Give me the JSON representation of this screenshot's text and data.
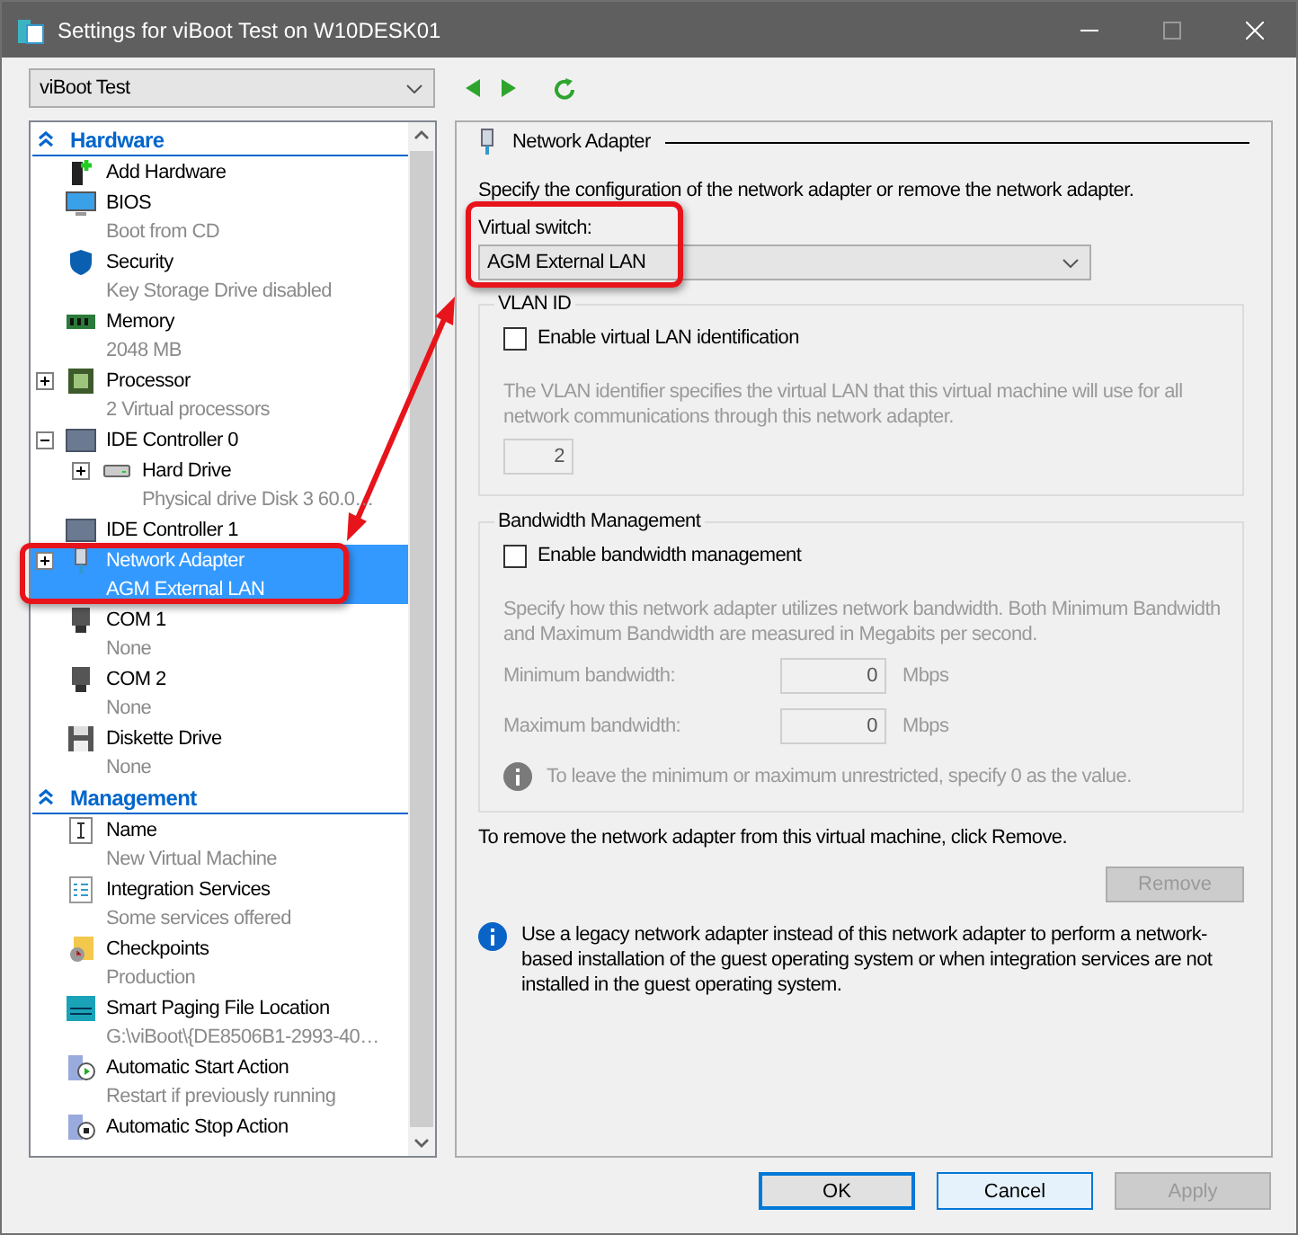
{
  "window": {
    "title": "Settings for viBoot Test on W10DESK01"
  },
  "vm_selector": {
    "value": "viBoot Test"
  },
  "sidebar": {
    "sections": [
      {
        "title": "Hardware",
        "expanded": true,
        "items": [
          {
            "kind": "add-hardware",
            "label": "Add Hardware",
            "selected": false
          },
          {
            "kind": "bios",
            "label": "BIOS",
            "detail": "Boot from CD",
            "selected": false
          },
          {
            "kind": "security",
            "label": "Security",
            "detail": "Key Storage Drive disabled",
            "selected": false
          },
          {
            "kind": "memory",
            "label": "Memory",
            "detail": "2048 MB",
            "selected": false
          },
          {
            "kind": "processor",
            "label": "Processor",
            "detail": "2 Virtual processors",
            "selected": false,
            "expanded": false
          },
          {
            "kind": "controller",
            "label": "IDE Controller 0",
            "selected": false,
            "expanded": true,
            "children": [
              {
                "kind": "hard-drive",
                "label": "Hard Drive",
                "detail": "Physical drive Disk 3 60.0…",
                "selected": false,
                "expanded": false
              }
            ]
          },
          {
            "kind": "controller",
            "label": "IDE Controller 1",
            "selected": false
          },
          {
            "kind": "network",
            "label": "Network Adapter",
            "detail": "AGM External LAN",
            "selected": true,
            "expanded": false
          },
          {
            "kind": "port",
            "label": "COM 1",
            "detail": "None",
            "selected": false
          },
          {
            "kind": "port",
            "label": "COM 2",
            "detail": "None",
            "selected": false
          },
          {
            "kind": "diskette",
            "label": "Diskette Drive",
            "detail": "None",
            "selected": false
          }
        ]
      },
      {
        "title": "Management",
        "expanded": true,
        "items": [
          {
            "kind": "name",
            "label": "Name",
            "detail": "New Virtual Machine",
            "selected": false
          },
          {
            "kind": "integration",
            "label": "Integration Services",
            "detail": "Some services offered",
            "selected": false
          },
          {
            "kind": "checkpoints",
            "label": "Checkpoints",
            "detail": "Production",
            "selected": false
          },
          {
            "kind": "paging",
            "label": "Smart Paging File Location",
            "detail": "G:\\viBoot\\{DE8506B1-2993-40…",
            "selected": false
          },
          {
            "kind": "auto-start",
            "label": "Automatic Start Action",
            "detail": "Restart if previously running",
            "selected": false
          },
          {
            "kind": "auto-stop",
            "label": "Automatic Stop Action",
            "selected": false
          }
        ]
      }
    ]
  },
  "panel": {
    "title": "Network Adapter",
    "description": "Specify the configuration of the network adapter or remove the network adapter.",
    "virtual_switch": {
      "label": "Virtual switch:",
      "value": "AGM External LAN"
    },
    "vlan": {
      "title": "VLAN ID",
      "checkbox": {
        "label": "Enable virtual LAN identification",
        "checked": false
      },
      "help": "The VLAN identifier specifies the virtual LAN that this virtual machine will use for all network communications through this network adapter.",
      "value": "2"
    },
    "bandwidth": {
      "title": "Bandwidth Management",
      "checkbox": {
        "label": "Enable bandwidth management",
        "checked": false
      },
      "help": "Specify how this network adapter utilizes network bandwidth. Both Minimum Bandwidth and Maximum Bandwidth are measured in Megabits per second.",
      "fields": [
        {
          "label": "Minimum bandwidth:",
          "value": "0",
          "unit": "Mbps"
        },
        {
          "label": "Maximum bandwidth:",
          "value": "0",
          "unit": "Mbps"
        }
      ],
      "note": "To leave the minimum or maximum unrestricted, specify 0 as the value."
    },
    "remove_text": "To remove the network adapter from this virtual machine, click Remove.",
    "remove_button": {
      "label": "Remove",
      "disabled": true
    },
    "info": "Use a legacy network adapter instead of this network adapter to perform a network-based installation of the guest operating system or when integration services are not installed in the guest operating system."
  },
  "buttons": [
    {
      "label": "OK",
      "disabled": false,
      "default": true,
      "hovered": false
    },
    {
      "label": "Cancel",
      "disabled": false,
      "default": false,
      "hovered": true
    },
    {
      "label": "Apply",
      "disabled": true,
      "default": false,
      "hovered": false
    }
  ]
}
